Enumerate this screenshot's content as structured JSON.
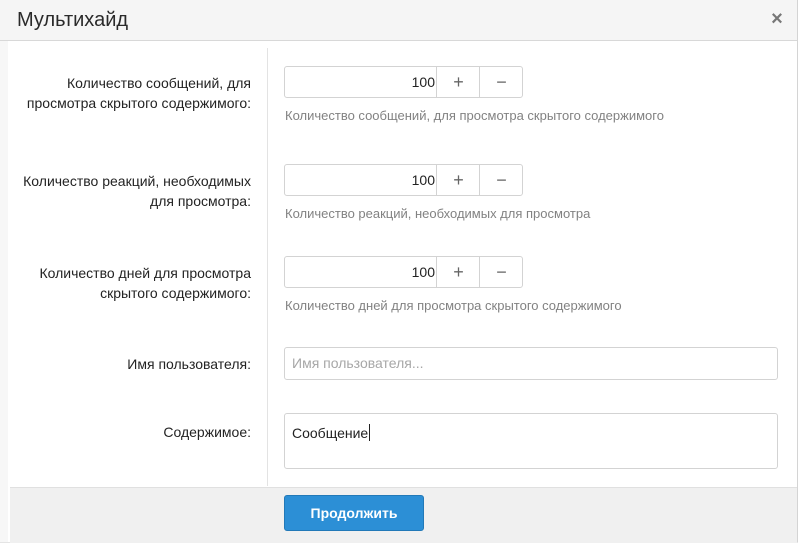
{
  "dialog": {
    "title": "Мультихайд",
    "close_symbol": "×"
  },
  "fields": {
    "messages": {
      "label": "Количество сообщений, для просмотра скрытого содержимого:",
      "value": "100",
      "hint": "Количество сообщений, для просмотра скрытого содержимого",
      "plus": "+",
      "minus": "−"
    },
    "reactions": {
      "label": "Количество реакций, необходимых для просмотра:",
      "value": "100",
      "hint": "Количество реакций, необходимых для просмотра",
      "plus": "+",
      "minus": "−"
    },
    "days": {
      "label": "Количество дней для просмотра скрытого содержимого:",
      "value": "100",
      "hint": "Количество дней для просмотра скрытого содержимого",
      "plus": "+",
      "minus": "−"
    },
    "username": {
      "label": "Имя пользователя:",
      "placeholder": "Имя пользователя...",
      "value": ""
    },
    "content": {
      "label": "Содержимое:",
      "value": "Сообщение"
    }
  },
  "footer": {
    "submit_label": "Продолжить"
  },
  "colors": {
    "primary": "#2c8fd6",
    "hint_text": "#828282"
  }
}
